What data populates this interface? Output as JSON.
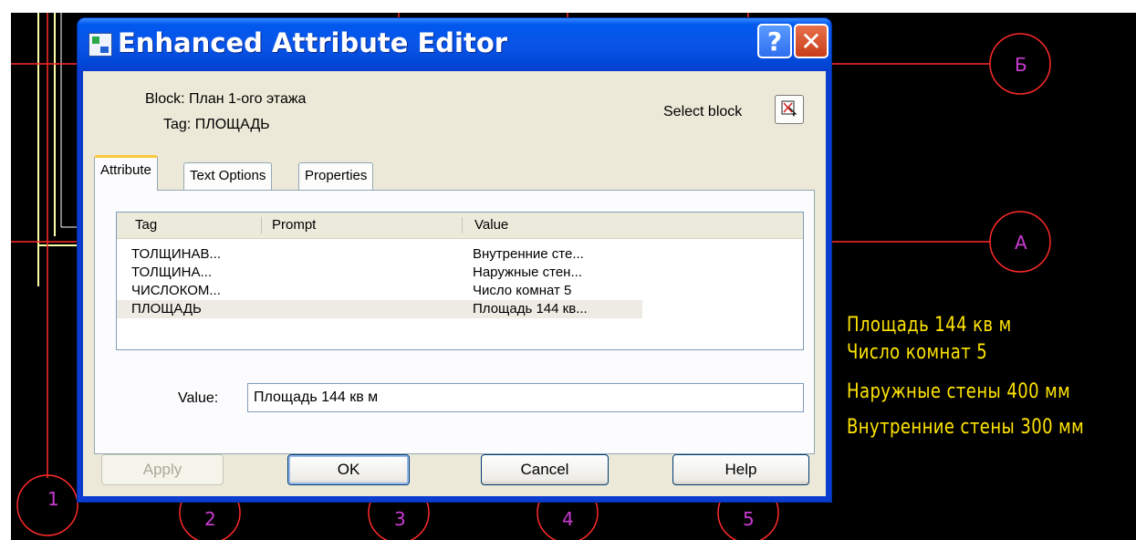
{
  "dialog": {
    "title": "Enhanced Attribute Editor",
    "help_glyph": "?",
    "close_glyph": "✕",
    "block_label": "Block: План 1-ого этажа",
    "tag_label": "Tag: ПЛОЩАДЬ",
    "select_block_label": "Select block",
    "tabs": [
      {
        "label": "Attribute",
        "active": true
      },
      {
        "label": "Text Options",
        "active": false
      },
      {
        "label": "Properties",
        "active": false
      }
    ],
    "columns": [
      "Tag",
      "Prompt",
      "Value"
    ],
    "rows": [
      {
        "tag": "ТОЛЩИНАВ...",
        "prompt": "",
        "value": "Внутренние сте..."
      },
      {
        "tag": "ТОЛЩИНА...",
        "prompt": "",
        "value": "Наружные стен..."
      },
      {
        "tag": "ЧИСЛОКОМ...",
        "prompt": "",
        "value": "Число комнат 5"
      },
      {
        "tag": "ПЛОЩАДЬ",
        "prompt": "",
        "value": "Площадь 144 кв...",
        "selected": true
      }
    ],
    "value_label": "Value:",
    "value_text": "Площадь 144 кв м",
    "buttons": {
      "apply": "Apply",
      "ok": "OK",
      "cancel": "Cancel",
      "help": "Help"
    }
  },
  "drawing": {
    "axis_labels": [
      "Б",
      "А",
      "1",
      "2",
      "3",
      "4",
      "5"
    ],
    "attribute_texts": [
      "Площадь 144 кв м",
      "Число комнат 5",
      "Наружные стены 400 мм",
      "Внутренние стены 300 мм"
    ],
    "colors": {
      "background": "#000000",
      "axis": "#ff2a2a",
      "text": "#ffe400",
      "walls": "#ffffaa"
    }
  },
  "colors": {
    "titlebar": "#0a55e8",
    "dialog_face": "#ece9d8",
    "close_button": "#c83d19",
    "tab_highlight": "#ffc83c"
  }
}
